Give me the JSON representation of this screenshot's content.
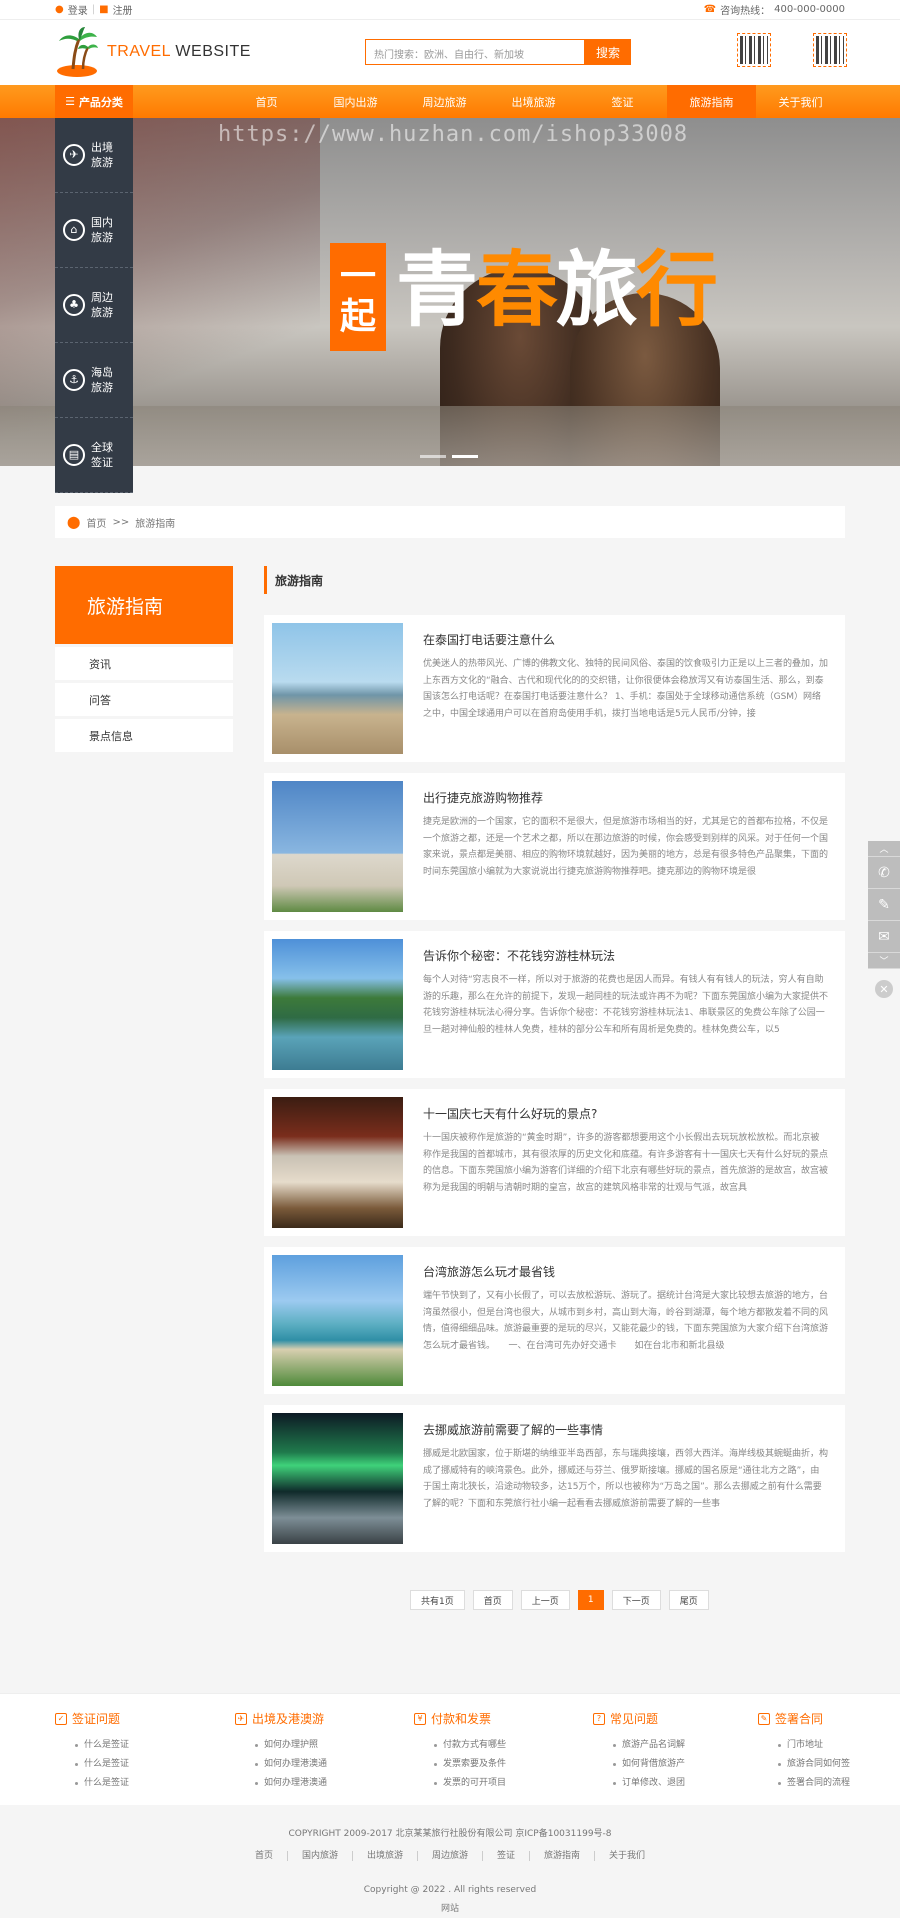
{
  "topbar": {
    "login": "登录",
    "register": "注册",
    "hotline_label": "咨询热线：",
    "hotline": "400-000-0000"
  },
  "header": {
    "logo_word_1": "TRAVEL",
    "logo_word_2": " WEBSITE",
    "search_placeholder": "热门搜索：欧洲、自由行、新加坡",
    "search_button": "搜索"
  },
  "nav": {
    "category_tab": "产品分类",
    "items": [
      "首页",
      "国内出游",
      "周边旅游",
      "出境旅游",
      "签证",
      "旅游指南",
      "关于我们"
    ],
    "active_index": 5
  },
  "banner": {
    "watermark": "https://www.huzhan.com/ishop33008",
    "slogan_box": "一起",
    "slogan_chars": [
      "青",
      "春",
      "旅",
      "行"
    ],
    "slogan_accent_color": "#ff8a00",
    "slide_count": 2,
    "active_slide": 1
  },
  "side_categories": [
    {
      "icon": "plane-icon",
      "label": "出境旅游"
    },
    {
      "icon": "temple-icon",
      "label": "国内旅游"
    },
    {
      "icon": "palm-icon",
      "label": "周边旅游"
    },
    {
      "icon": "ship-icon",
      "label": "海岛旅游"
    },
    {
      "icon": "passport-icon",
      "label": "全球签证"
    }
  ],
  "breadcrumb": {
    "home": "首页",
    "separator": ">>",
    "current": "旅游指南"
  },
  "sidebar": {
    "title": "旅游指南",
    "items": [
      "资讯",
      "问答",
      "景点信息"
    ]
  },
  "list_title": "旅游指南",
  "articles": [
    {
      "title": "在泰国打电话要注意什么",
      "desc": "优美迷人的热带风光、广博的佛教文化、独特的民间风俗、泰国的饮食吸引力正是以上三者的叠加，加上东西方文化的“融合、古代和现代化的的交织错，让你很便体会稳放泻又有访泰国生活、那么，到泰国该怎么打电话呢？在泰国打电话要注意什么？ 1、手机：泰国处于全球移动通信系统（GSM）网络之中，中国全球通用户可以在首府岛使用手机，拨打当地电话是5元人民币/分钟，接",
      "thumb": "beach-parasail"
    },
    {
      "title": "出行捷克旅游购物推荐",
      "desc": "捷克是欧洲的一个国家，它的面积不是很大，但是旅游市场相当的好，尤其是它的首都布拉格，不仅是一个旅游之都，还是一个艺术之都，所以在那边旅游的时候，你会感受到别样的风采。对于任何一个国家来说，景点都是美丽、相应的购物环境就越好，因为美丽的地方，总是有很多特色产品聚集，下面的时间东莞国旅小编就为大家说说出行捷克旅游购物推荐吧。捷克那边的购物环境是很",
      "thumb": "church"
    },
    {
      "title": "告诉你个秘密：不花钱穷游桂林玩法",
      "desc": "每个人对待“穷志良不一样，所以对于旅游的花费也是因人而异。有钱人有有钱人的玩法，穷人有自助游的乐趣，那么在允许的前提下，发现一趟同桂的玩法或许再不为呢？下面东莞国旅小编为大家提供不花钱穷游桂林玩法心得分享。告诉你个秘密：不花钱穷游桂林玩法1、串联景区的免费公车除了公园一旦一趟对神仙般的桂林人免费，桂林的部分公车和所有周析是免费的。桂林免费公车，以5",
      "thumb": "karst-lake"
    },
    {
      "title": "十一国庆七天有什么好玩的景点?",
      "desc": "十一国庆被称作是旅游的“黄金时期”，许多的游客都想要用这个小长假出去玩玩放松放松。而北京被称作是我国的首都城市，其有很浓厚的历史文化和底蕴。有许多游客有十一国庆七天有什么好玩的景点的信息。下面东莞国旅小编为游客们详细的介绍下北京有哪些好玩的景点，首先旅游的是故宫，故宫被称为是我国的明朝与清朝时期的皇宫，故宫的建筑风格非常的壮观与气派，故宫具",
      "thumb": "palace-gate"
    },
    {
      "title": "台湾旅游怎么玩才最省钱",
      "desc": "端午节快到了，又有小长假了，可以去放松游玩、游玩了。据统计台湾是大家比较想去旅游的地方，台湾虽然很小，但是台湾也很大，从城市到乡村，高山到大海，岭谷到湖潭，每个地方都散发着不同的风情，值得细细品味。旅游最重要的是玩的尽兴，又能花最少的钱，下面东莞国旅为大家介绍下台湾旅游怎么玩才最省钱。　　一、在台湾可先办好交通卡　　如在台北市和新北县级",
      "thumb": "coast"
    },
    {
      "title": "去挪威旅游前需要了解的一些事情",
      "desc": "挪威是北欧国家，位于斯堪的纳维亚半岛西部，东与瑞典接壤，西邻大西洋。海岸线极其蜿蜒曲折，构成了挪威特有的峡湾景色。此外，挪威还与芬兰、俄罗斯接壤。挪威的国名原是“通往北方之路”，由于国土南北狭长，沿途动物较多，达15万个，所以也被称为“万岛之国”。那么去挪威之前有什么需要了解的呢？下面和东莞旅行社小编一起看看去挪威旅游前需要了解的一些事",
      "thumb": "aurora"
    }
  ],
  "pager": {
    "total": "共有1页",
    "first": "首页",
    "prev": "上一页",
    "current": "1",
    "next": "下一页",
    "last": "尾页"
  },
  "float_tools": [
    "chevron-up-icon",
    "phone-icon",
    "edit-icon",
    "mail-icon",
    "chevron-down-icon",
    "close-icon"
  ],
  "footer_help": [
    {
      "title": "签证问题",
      "icon": "visa-icon",
      "links": [
        "什么是签证",
        "什么是签证",
        "什么是签证"
      ]
    },
    {
      "title": "出境及港澳游",
      "icon": "travel-icon",
      "links": [
        "如何办理护照",
        "如何办理港澳通",
        "如何办理港澳通"
      ]
    },
    {
      "title": "付款和发票",
      "icon": "invoice-icon",
      "links": [
        "付款方式有哪些",
        "发票索要及条件",
        "发票的可开项目"
      ]
    },
    {
      "title": "常见问题",
      "icon": "question-icon",
      "links": [
        "旅游产品名词解",
        "如何背借旅游产",
        "订单修改、退团"
      ]
    },
    {
      "title": "签署合同",
      "icon": "contract-icon",
      "links": [
        "门市地址",
        "旅游合同如何签",
        "签署合同的流程"
      ]
    }
  ],
  "footer": {
    "copyright": "COPYRIGHT 2009-2017 北京某某旅行社股份有限公司 京ICP备10031199号-8",
    "links": [
      "首页",
      "国内旅游",
      "出境旅游",
      "周边旅游",
      "签证",
      "旅游指南",
      "关于我们"
    ],
    "rights": "Copyright @ 2022 . All rights reserved",
    "small": "网站"
  },
  "colors": {
    "accent": "#ff6c00",
    "nav_gradient_top": "#ff9a1e",
    "side_category_bg": "#333b46"
  }
}
